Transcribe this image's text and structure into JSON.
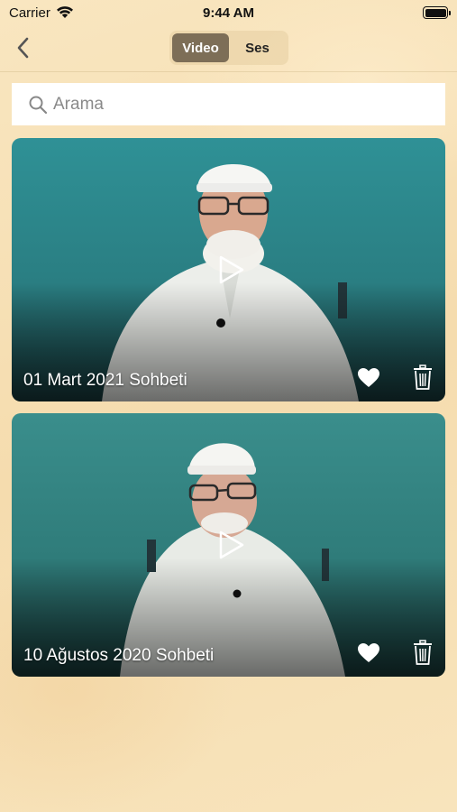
{
  "status_bar": {
    "carrier": "Carrier",
    "time": "9:44 AM"
  },
  "nav": {
    "back_icon": "chevron-left-icon",
    "segments": [
      "Video",
      "Ses"
    ],
    "selected_segment": "Video"
  },
  "search": {
    "placeholder": "Arama",
    "value": ""
  },
  "videos": [
    {
      "title": "01 Mart 2021 Sohbeti",
      "favorite": true
    },
    {
      "title": "10 Ağustos 2020 Sohbeti",
      "favorite": true
    }
  ],
  "colors": {
    "background": "#f7e2b8",
    "segment_active": "#7d6e57",
    "video_backdrop": "#2b8e92"
  }
}
